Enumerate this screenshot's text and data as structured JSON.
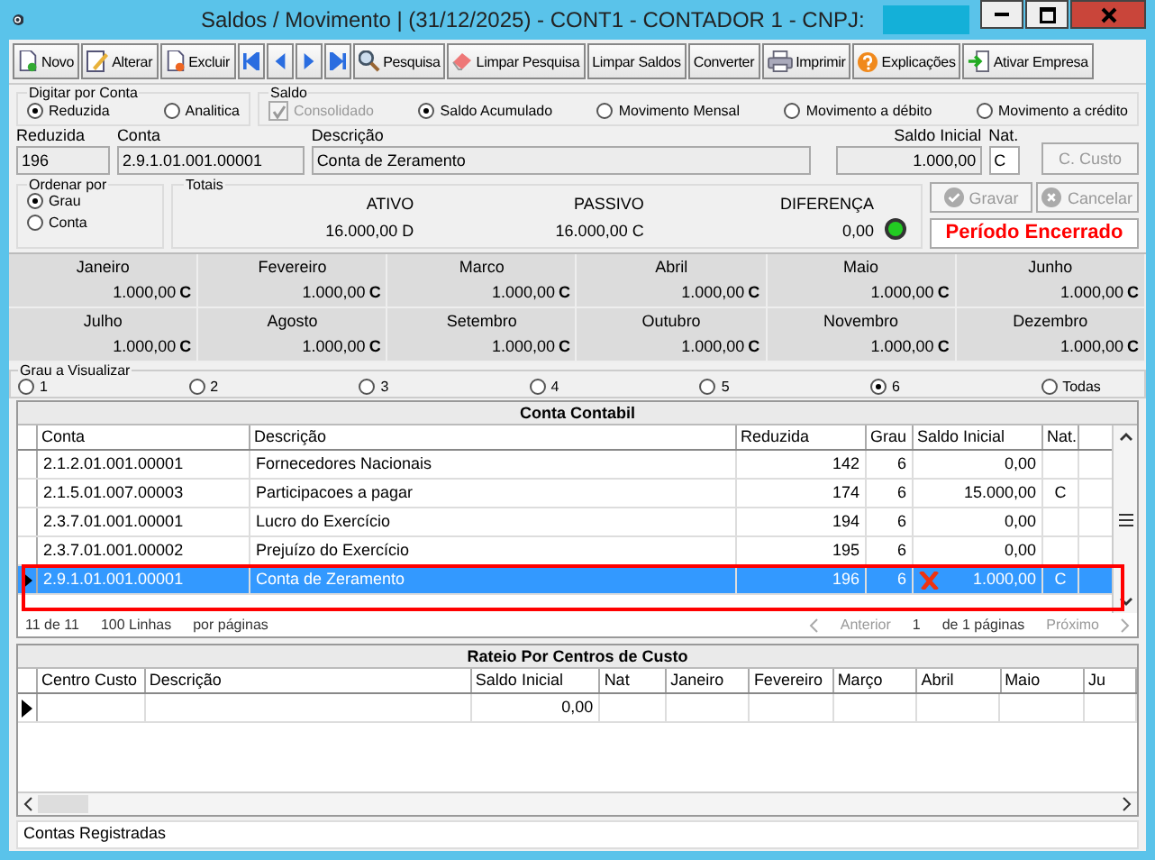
{
  "window": {
    "title": "Saldos / Movimento | (31/12/2025) - CONT1 - CONTADOR 1  - CNPJ:"
  },
  "toolbar": [
    {
      "kind": "doc",
      "label": "Novo"
    },
    {
      "kind": "pencil",
      "label": "Alterar"
    },
    {
      "kind": "delete",
      "label": "Excluir"
    },
    {
      "kind": "first"
    },
    {
      "kind": "prev"
    },
    {
      "kind": "next"
    },
    {
      "kind": "last"
    },
    {
      "kind": "search",
      "label": "Pesquisa"
    },
    {
      "kind": "eraser",
      "label": "Limpar Pesquisa"
    },
    {
      "kind": "text",
      "label": "Limpar Saldos"
    },
    {
      "kind": "text",
      "label": "Converter"
    },
    {
      "kind": "printer",
      "label": "Imprimir"
    },
    {
      "kind": "help",
      "label": "Explicações"
    },
    {
      "kind": "enter",
      "label": "Ativar Empresa"
    }
  ],
  "digitar": {
    "label": "Digitar por Conta",
    "options": [
      {
        "label": "Reduzida",
        "selected": true
      },
      {
        "label": "Analitica",
        "selected": false
      }
    ]
  },
  "saldo": {
    "label": "Saldo",
    "consolidado": {
      "label": "Consolidado",
      "checked": true,
      "disabled": true
    },
    "options": [
      {
        "label": "Saldo Acumulado",
        "selected": true
      },
      {
        "label": "Movimento Mensal",
        "selected": false
      },
      {
        "label": "Movimento a débito",
        "selected": false
      },
      {
        "label": "Movimento a crédito",
        "selected": false
      }
    ]
  },
  "fields": {
    "reduzida": {
      "label": "Reduzida",
      "value": "196"
    },
    "conta": {
      "label": "Conta",
      "value": "2.9.1.01.001.00001"
    },
    "descricao": {
      "label": "Descrição",
      "value": "Conta de Zeramento"
    },
    "saldo_inicial": {
      "label": "Saldo Inicial",
      "value": "1.000,00"
    },
    "nat": {
      "label": "Nat.",
      "value": "C"
    },
    "custo_button": {
      "label": "C. Custo",
      "disabled": true
    }
  },
  "ordenar": {
    "label": "Ordenar por",
    "options": [
      {
        "label": "Grau",
        "selected": true
      },
      {
        "label": "Conta",
        "selected": false
      }
    ]
  },
  "totais": {
    "label": "Totais",
    "columns": [
      {
        "label": "ATIVO",
        "value": "16.000,00 D"
      },
      {
        "label": "PASSIVO",
        "value": "16.000,00 C"
      },
      {
        "label": "DIFERENÇA",
        "value": "0,00"
      }
    ]
  },
  "actions": [
    {
      "kind": "check",
      "label": "Gravar",
      "disabled": true
    },
    {
      "kind": "cancel",
      "label": "Cancelar",
      "disabled": true
    }
  ],
  "period_status": "Período Encerrado",
  "months": [
    {
      "name": "Janeiro",
      "value": "1.000,00",
      "nat": "C"
    },
    {
      "name": "Fevereiro",
      "value": "1.000,00",
      "nat": "C"
    },
    {
      "name": "Marco",
      "value": "1.000,00",
      "nat": "C"
    },
    {
      "name": "Abril",
      "value": "1.000,00",
      "nat": "C"
    },
    {
      "name": "Maio",
      "value": "1.000,00",
      "nat": "C"
    },
    {
      "name": "Junho",
      "value": "1.000,00",
      "nat": "C"
    },
    {
      "name": "Julho",
      "value": "1.000,00",
      "nat": "C"
    },
    {
      "name": "Agosto",
      "value": "1.000,00",
      "nat": "C"
    },
    {
      "name": "Setembro",
      "value": "1.000,00",
      "nat": "C"
    },
    {
      "name": "Outubro",
      "value": "1.000,00",
      "nat": "C"
    },
    {
      "name": "Novembro",
      "value": "1.000,00",
      "nat": "C"
    },
    {
      "name": "Dezembro",
      "value": "1.000,00",
      "nat": "C"
    }
  ],
  "grau": {
    "label": "Grau a Visualizar",
    "options": [
      {
        "label": "1",
        "selected": false
      },
      {
        "label": "2",
        "selected": false
      },
      {
        "label": "3",
        "selected": false
      },
      {
        "label": "4",
        "selected": false
      },
      {
        "label": "5",
        "selected": false
      },
      {
        "label": "6",
        "selected": true
      },
      {
        "label": "Todas",
        "selected": false
      }
    ]
  },
  "grid": {
    "title": "Conta Contabil",
    "columns": [
      "Conta",
      "Descrição",
      "Reduzida",
      "Grau",
      "Saldo Inicial",
      "Nat."
    ],
    "rows": [
      {
        "cells": [
          "2.1.2.01.001.00001",
          "Fornecedores Nacionais",
          "142",
          "6",
          "0,00",
          ""
        ],
        "selected": false
      },
      {
        "cells": [
          "2.1.5.01.007.00003",
          "Participacoes a pagar",
          "174",
          "6",
          "15.000,00",
          "C"
        ],
        "selected": false
      },
      {
        "cells": [
          "2.3.7.01.001.00001",
          "Lucro do Exercício",
          "194",
          "6",
          "0,00",
          ""
        ],
        "selected": false
      },
      {
        "cells": [
          "2.3.7.01.001.00002",
          "Prejuízo do Exercício",
          "195",
          "6",
          "0,00",
          ""
        ],
        "selected": false
      },
      {
        "cells": [
          "2.9.1.01.001.00001",
          "Conta de Zeramento",
          "196",
          "6",
          "1.000,00",
          "C"
        ],
        "selected": true
      }
    ]
  },
  "pager": {
    "count": "11  de  11",
    "lines": "100 Linhas",
    "per_page": "por páginas",
    "previous": "Anterior",
    "page": "1",
    "of_pages": "de 1 páginas",
    "next": "Próximo"
  },
  "rateio": {
    "title": "Rateio Por Centros de Custo",
    "columns": [
      "Centro Custo",
      "Descrição",
      "Saldo Inicial",
      "Nat",
      "Janeiro",
      "Fevereiro",
      "Março",
      "Abril",
      "Maio",
      "Ju"
    ],
    "rows": [
      {
        "cells": [
          "",
          "",
          "0,00",
          "",
          "",
          "",
          "",
          "",
          "",
          ""
        ]
      }
    ]
  },
  "status_bar": "Contas Registradas"
}
